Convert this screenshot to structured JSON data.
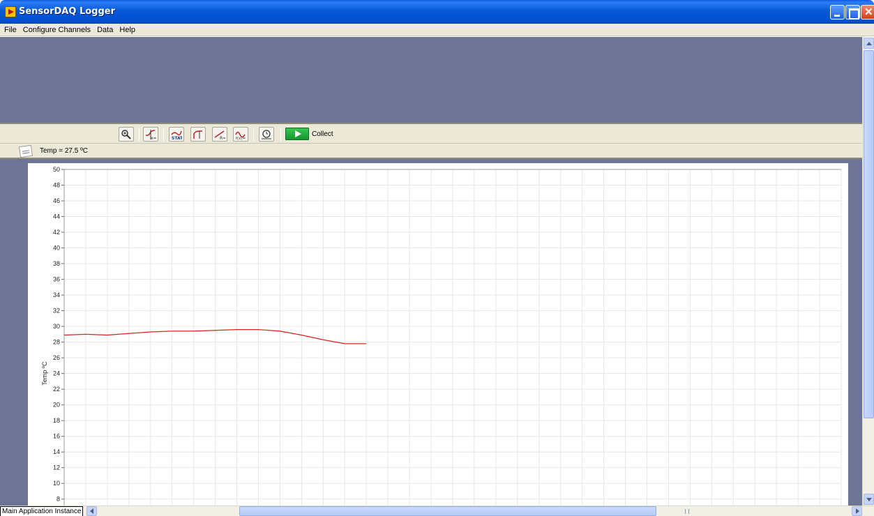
{
  "window": {
    "title": "SensorDAQ Logger"
  },
  "menu": {
    "items": [
      "File",
      "Configure Channels",
      "Data",
      "Help"
    ]
  },
  "toolbar": {
    "tools": [
      {
        "name": "zoom-icon"
      },
      {
        "name": "examine-icon"
      },
      {
        "name": "statistics-icon"
      },
      {
        "name": "tangent-icon"
      },
      {
        "name": "linear-fit-icon"
      },
      {
        "name": "curve-fit-icon"
      },
      {
        "name": "data-collection-settings-icon"
      }
    ],
    "collect_label": "Collect",
    "collect_color": "#22b03c"
  },
  "readout": {
    "text": "Temp = 27.5 ºC"
  },
  "statusbar": {
    "instance": "Main Application Instance"
  },
  "chart_data": {
    "type": "line",
    "ylabel": "Temp ºC",
    "xlabel": "",
    "ylim": [
      7,
      50
    ],
    "yticks": [
      50,
      48,
      46,
      44,
      42,
      40,
      38,
      36,
      34,
      32,
      30,
      28,
      26,
      24,
      22,
      20,
      18,
      16,
      14,
      12,
      10,
      8
    ],
    "xlim": [
      0,
      36
    ],
    "grid": true,
    "series": [
      {
        "color": "#e02020",
        "x": [
          0,
          1,
          2,
          3,
          4,
          5,
          6,
          7,
          8,
          9,
          10,
          11,
          12,
          13,
          14
        ],
        "y": [
          28.9,
          29.0,
          28.9,
          29.1,
          29.3,
          29.4,
          29.4,
          29.5,
          29.6,
          29.6,
          29.4,
          28.9,
          28.3,
          27.8,
          27.8
        ]
      }
    ]
  }
}
